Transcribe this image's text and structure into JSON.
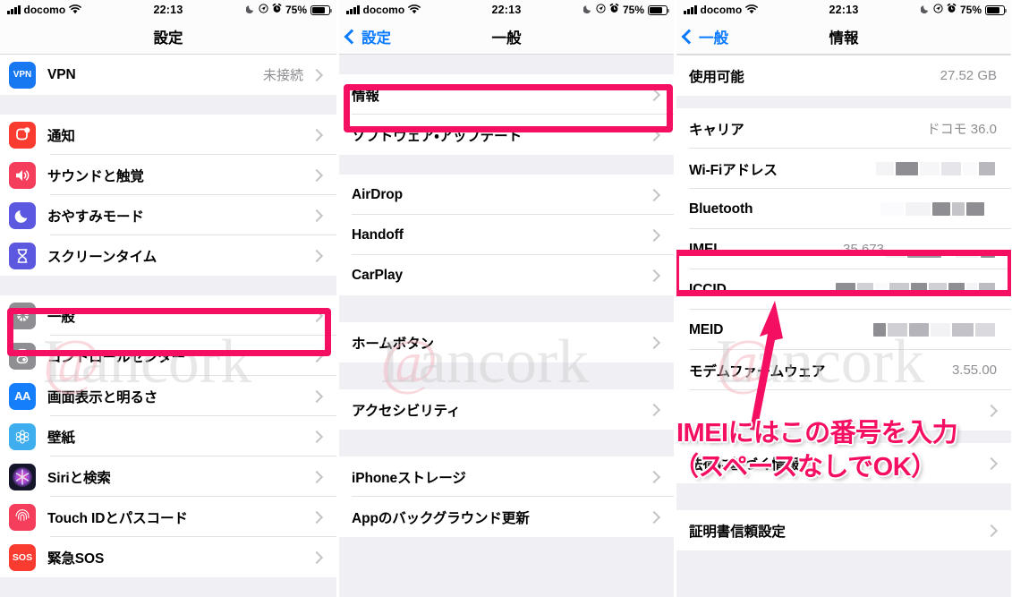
{
  "statusbar": {
    "carrier": "docomo",
    "time": "22:13",
    "battery_pct": "75%",
    "icons": {
      "signal": "signal-bars-icon",
      "wifi": "wifi-icon",
      "moon": "do-not-disturb-moon-icon",
      "location": "location-arrow-icon",
      "alarm": "alarm-clock-icon",
      "battery": "battery-icon"
    }
  },
  "screen1": {
    "nav_title": "設定",
    "groups": [
      {
        "rows": [
          {
            "icon": "vpn-icon",
            "icon_text": "VPN",
            "icon_bg": "#1778f2",
            "label": "VPN",
            "value": "未接続",
            "chevron": true
          }
        ]
      },
      {
        "rows": [
          {
            "icon": "notifications-icon",
            "icon_text": "",
            "icon_bg": "#fa3b2f",
            "label": "通知",
            "value": "",
            "chevron": true
          },
          {
            "icon": "sounds-haptics-icon",
            "icon_text": "",
            "icon_bg": "#f53d5c",
            "label": "サウンドと触覚",
            "value": "",
            "chevron": true
          },
          {
            "icon": "do-not-disturb-icon",
            "icon_text": "",
            "icon_bg": "#5c58e0",
            "label": "おやすみモード",
            "value": "",
            "chevron": true
          },
          {
            "icon": "screen-time-icon",
            "icon_text": "",
            "icon_bg": "#5c58e0",
            "label": "スクリーンタイム",
            "value": "",
            "chevron": true
          }
        ]
      },
      {
        "rows": [
          {
            "icon": "gear-icon",
            "icon_text": "",
            "icon_bg": "#8e8e93",
            "label": "一般",
            "value": "",
            "chevron": true,
            "highlighted": true
          },
          {
            "icon": "control-center-icon",
            "icon_text": "",
            "icon_bg": "#8e8e93",
            "label": "コントロールセンター",
            "value": "",
            "chevron": true
          },
          {
            "icon": "display-brightness-icon",
            "icon_text": "AA",
            "icon_bg": "#157efb",
            "label": "画面表示と明るさ",
            "value": "",
            "chevron": true
          },
          {
            "icon": "wallpaper-icon",
            "icon_text": "",
            "icon_bg": "#3eaeee",
            "label": "壁紙",
            "value": "",
            "chevron": true
          },
          {
            "icon": "siri-search-icon",
            "icon_text": "",
            "icon_bg": "#1a1a2e",
            "label": "Siriと検索",
            "value": "",
            "chevron": true
          },
          {
            "icon": "touch-id-icon",
            "icon_text": "",
            "icon_bg": "#f53d5c",
            "label": "Touch IDとパスコード",
            "value": "",
            "chevron": true
          },
          {
            "icon": "emergency-sos-icon",
            "icon_text": "SOS",
            "icon_bg": "#fa3b2f",
            "label": "緊急SOS",
            "value": "",
            "chevron": true
          }
        ]
      }
    ]
  },
  "screen2": {
    "nav_back": "設定",
    "nav_title": "一般",
    "groups": [
      {
        "rows": [
          {
            "label": "情報",
            "value": "",
            "chevron": true,
            "highlighted": true
          },
          {
            "label": "ソフトウェア・アップデート",
            "value": "",
            "chevron": true
          }
        ]
      },
      {
        "rows": [
          {
            "label": "AirDrop",
            "value": "",
            "chevron": true
          },
          {
            "label": "Handoff",
            "value": "",
            "chevron": true
          },
          {
            "label": "CarPlay",
            "value": "",
            "chevron": true
          }
        ]
      },
      {
        "rows": [
          {
            "label": "ホームボタン",
            "value": "",
            "chevron": true
          }
        ]
      },
      {
        "rows": [
          {
            "label": "アクセシビリティ",
            "value": "",
            "chevron": true
          }
        ]
      },
      {
        "rows": [
          {
            "label": "iPhoneストレージ",
            "value": "",
            "chevron": true
          },
          {
            "label": "Appのバックグラウンド更新",
            "value": "",
            "chevron": true
          }
        ]
      }
    ]
  },
  "screen3": {
    "nav_back": "一般",
    "nav_title": "情報",
    "groups": [
      {
        "rows": [
          {
            "label": "使用可能",
            "value": "27.52 GB",
            "chevron": false
          }
        ]
      },
      {
        "rows": [
          {
            "label": "キャリア",
            "value": "ドコモ 36.0",
            "chevron": false
          },
          {
            "label": "Wi-Fiアドレス",
            "value": "",
            "redacted": true,
            "chevron": false
          },
          {
            "label": "Bluetooth",
            "value": "",
            "redacted": true,
            "chevron": false
          },
          {
            "label": "IMEI",
            "value": "35 673",
            "redacted": true,
            "chevron": false,
            "highlighted": true
          },
          {
            "label": "ICCID",
            "value": "",
            "redacted": true,
            "chevron": false
          },
          {
            "label": "MEID",
            "value": "",
            "redacted": true,
            "chevron": false
          },
          {
            "label": "モデムファームウェア",
            "value": "3.55.00",
            "chevron": false
          },
          {
            "label": "",
            "value": "",
            "chevron": true
          }
        ]
      },
      {
        "rows": [
          {
            "label": "法律に基づく情報",
            "value": "",
            "chevron": true
          }
        ]
      },
      {
        "rows": [
          {
            "label": "証明書信頼設定",
            "value": "",
            "chevron": true
          }
        ]
      }
    ]
  },
  "annotation": {
    "line1": "IMEIにはこの番号を入力",
    "line2": "（スペースなしでOK）",
    "arrow": "arrow-pointing-to-imei",
    "color": "#f50f63"
  },
  "watermark": {
    "text": "Lancork",
    "mark": "@"
  },
  "colors": {
    "highlight": "#f50f63",
    "accent_blue": "#0a7bff",
    "group_bg": "#efeff4",
    "value_gray": "#8e8e93"
  }
}
